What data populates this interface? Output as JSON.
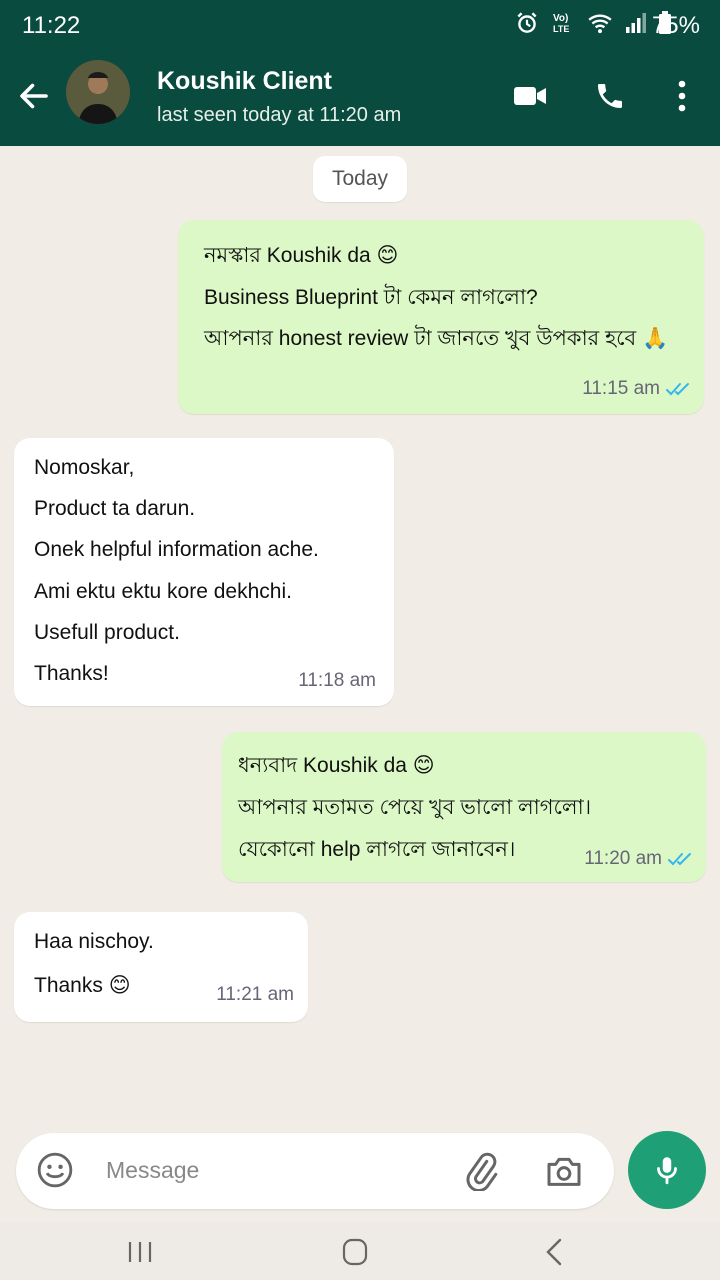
{
  "status_bar": {
    "time": "11:22",
    "battery": "75%"
  },
  "header": {
    "contact_name": "Koushik Client",
    "last_seen": "last seen today at 11:20 am"
  },
  "chat": {
    "date_label": "Today",
    "messages": [
      {
        "direction": "out",
        "lines": [
          "নমস্কার Koushik da 😊",
          "Business Blueprint টা কেমন লাগলো?",
          "আপনার honest review টা জানতে খুব উপকার হবে 🙏"
        ],
        "time": "11:15 am"
      },
      {
        "direction": "in",
        "lines": [
          "Nomoskar,",
          "Product ta darun.",
          "Onek helpful information ache.",
          "Ami ektu ektu kore dekhchi.",
          "Usefull product.",
          "Thanks!"
        ],
        "time": "11:18 am"
      },
      {
        "direction": "out",
        "lines": [
          "ধন্যবাদ Koushik da 😊",
          "আপনার মতামত পেয়ে খুব ভালো লাগলো।",
          "যেকোনো help লাগলে জানাবেন।"
        ],
        "time": "11:20 am"
      },
      {
        "direction": "in",
        "lines": [
          "Haa nischoy.",
          "Thanks 😊"
        ],
        "time": "11:21 am"
      }
    ]
  },
  "input": {
    "placeholder": "Message"
  },
  "colors": {
    "header": "#0a4b3f",
    "outgoing": "#dcf8c6",
    "incoming": "#ffffff",
    "accent": "#1e9f76",
    "ticks": "#34b7f1"
  }
}
